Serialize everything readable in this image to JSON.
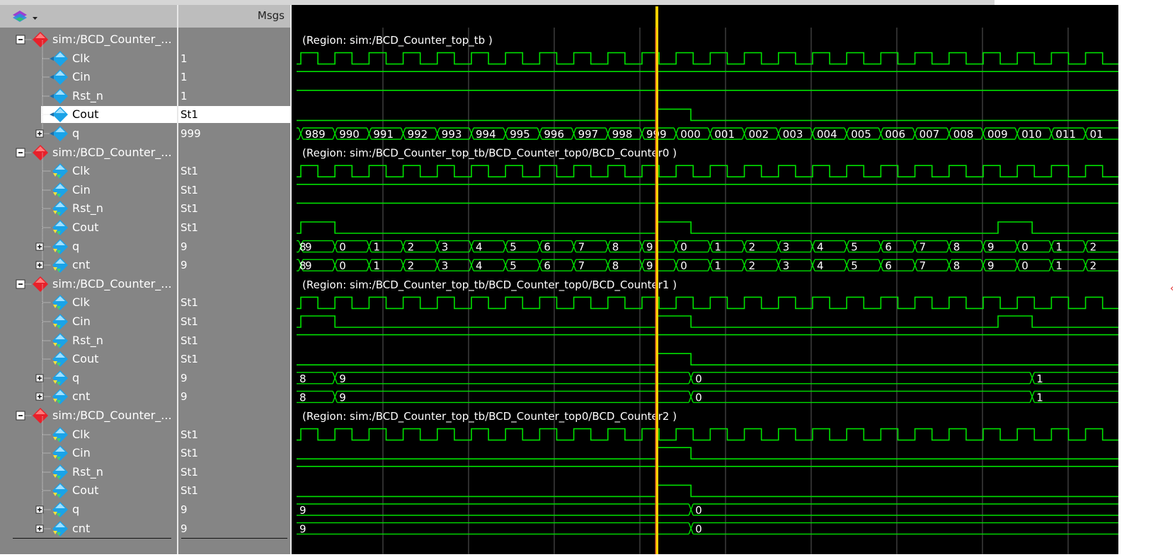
{
  "header": {
    "msgs_label": "Msgs"
  },
  "signals": [
    {
      "kind": "group",
      "name": "sim:/BCD_Counter_...",
      "value": ""
    },
    {
      "kind": "in",
      "name": "Clk",
      "value": "1"
    },
    {
      "kind": "in",
      "name": "Cin",
      "value": "1"
    },
    {
      "kind": "in",
      "name": "Rst_n",
      "value": "1"
    },
    {
      "kind": "in",
      "name": "Cout",
      "value": "St1",
      "selected": true
    },
    {
      "kind": "bus",
      "name": "q",
      "value": "999"
    },
    {
      "kind": "group",
      "name": "sim:/BCD_Counter_...",
      "value": ""
    },
    {
      "kind": "in",
      "name": "Clk",
      "value": "St1"
    },
    {
      "kind": "in",
      "name": "Cin",
      "value": "St1"
    },
    {
      "kind": "in",
      "name": "Rst_n",
      "value": "St1"
    },
    {
      "kind": "out",
      "name": "Cout",
      "value": "St1"
    },
    {
      "kind": "bus",
      "name": "q",
      "value": "9"
    },
    {
      "kind": "bus",
      "name": "cnt",
      "value": "9"
    },
    {
      "kind": "group",
      "name": "sim:/BCD_Counter_...",
      "value": ""
    },
    {
      "kind": "in",
      "name": "Clk",
      "value": "St1"
    },
    {
      "kind": "in",
      "name": "Cin",
      "value": "St1"
    },
    {
      "kind": "in",
      "name": "Rst_n",
      "value": "St1"
    },
    {
      "kind": "out",
      "name": "Cout",
      "value": "St1"
    },
    {
      "kind": "bus",
      "name": "q",
      "value": "9"
    },
    {
      "kind": "bus",
      "name": "cnt",
      "value": "9"
    },
    {
      "kind": "group",
      "name": "sim:/BCD_Counter_...",
      "value": ""
    },
    {
      "kind": "in",
      "name": "Clk",
      "value": "St1"
    },
    {
      "kind": "in",
      "name": "Cin",
      "value": "St1"
    },
    {
      "kind": "in",
      "name": "Rst_n",
      "value": "St1"
    },
    {
      "kind": "out",
      "name": "Cout",
      "value": "St1"
    },
    {
      "kind": "bus",
      "name": "q",
      "value": "9"
    },
    {
      "kind": "bus",
      "name": "cnt",
      "value": "9"
    }
  ],
  "waves": {
    "regions": [
      "(Region: sim:/BCD_Counter_top_tb )",
      "(Region: sim:/BCD_Counter_top_tb/BCD_Counter_top0/BCD_Counter0 )",
      "(Region: sim:/BCD_Counter_top_tb/BCD_Counter_top0/BCD_Counter1 )",
      "(Region: sim:/BCD_Counter_top_tb/BCD_Counter_top0/BCD_Counter2 )"
    ],
    "top_q": [
      "",
      "989",
      "990",
      "991",
      "992",
      "993",
      "994",
      "995",
      "996",
      "997",
      "998",
      "999",
      "000",
      "001",
      "002",
      "003",
      "004",
      "005",
      "006",
      "007",
      "008",
      "009",
      "010",
      "011",
      "01"
    ],
    "c0_digits": [
      "8",
      "9",
      "0",
      "1",
      "2",
      "3",
      "4",
      "5",
      "6",
      "7",
      "8",
      "9",
      "0",
      "1",
      "2",
      "3",
      "4",
      "5",
      "6",
      "7",
      "8",
      "9",
      "0",
      "1",
      "2"
    ],
    "c1_digits": [
      "8",
      "9",
      "0",
      "1"
    ],
    "c2_digits": [
      "9",
      "0"
    ]
  },
  "colors": {
    "wave": "#00e000",
    "cursor": "#ffd000",
    "group_icon": "#e8202a",
    "signal_icon": "#1aa3e8"
  }
}
